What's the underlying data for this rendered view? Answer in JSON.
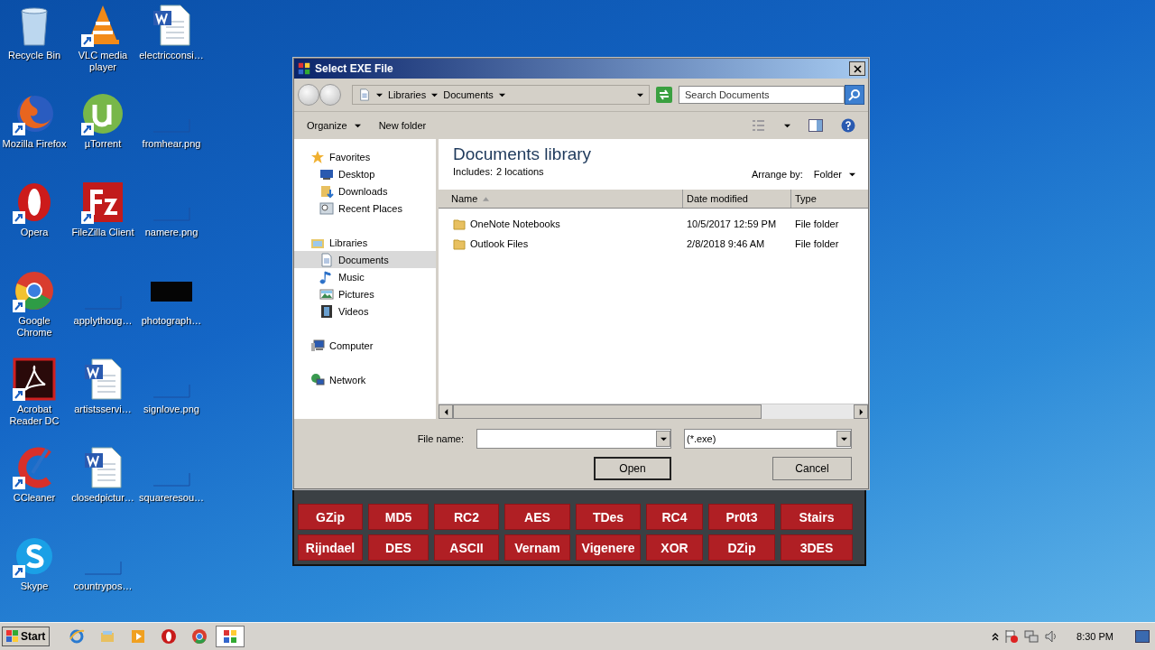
{
  "desktop": {
    "icons": [
      {
        "label": "Recycle Bin",
        "kind": "recycle",
        "shortcut": false
      },
      {
        "label": "Mozilla Firefox",
        "kind": "firefox",
        "shortcut": true
      },
      {
        "label": "Opera",
        "kind": "opera",
        "shortcut": true
      },
      {
        "label": "Google Chrome",
        "kind": "chrome",
        "shortcut": true
      },
      {
        "label": "Acrobat Reader DC",
        "kind": "acrobat",
        "shortcut": true
      },
      {
        "label": "CCleaner",
        "kind": "ccleaner",
        "shortcut": true
      },
      {
        "label": "Skype",
        "kind": "skype",
        "shortcut": true
      },
      {
        "label": "VLC media player",
        "kind": "vlc",
        "shortcut": true
      },
      {
        "label": "µTorrent",
        "kind": "utorrent",
        "shortcut": true
      },
      {
        "label": "FileZilla Client",
        "kind": "filezilla",
        "shortcut": true
      },
      {
        "label": "applythoug…",
        "kind": "image",
        "shortcut": false
      },
      {
        "label": "artistsservi…",
        "kind": "word",
        "shortcut": false
      },
      {
        "label": "closedpictur…",
        "kind": "word",
        "shortcut": false
      },
      {
        "label": "countrypos…",
        "kind": "image",
        "shortcut": false
      },
      {
        "label": "electricconsi…",
        "kind": "word",
        "shortcut": false
      },
      {
        "label": "fromhear.png",
        "kind": "image",
        "shortcut": false
      },
      {
        "label": "namere.png",
        "kind": "image",
        "shortcut": false
      },
      {
        "label": "photograph…",
        "kind": "dark-image",
        "shortcut": false
      },
      {
        "label": "signlove.png",
        "kind": "image",
        "shortcut": false
      },
      {
        "label": "squareresou…",
        "kind": "image",
        "shortcut": false
      }
    ]
  },
  "app_window": {
    "buttons": [
      [
        "GZip",
        "MD5",
        "RC2",
        "AES",
        "TDes",
        "RC4",
        "Pr0t3",
        "Stairs"
      ],
      [
        "Rijndael",
        "DES",
        "ASCII",
        "Vernam",
        "Vigenere",
        "XOR",
        "DZip",
        "3DES"
      ]
    ]
  },
  "dialog": {
    "title": "Select EXE File",
    "breadcrumb": [
      "Libraries",
      "Documents"
    ],
    "search": {
      "placeholder": "Search Documents"
    },
    "toolbar": [
      "Organize",
      "New folder"
    ],
    "nav": [
      {
        "label": "Favorites",
        "kind": "favorites",
        "selected": false,
        "children": [
          {
            "label": "Desktop",
            "kind": "desktop",
            "selected": false
          },
          {
            "label": "Downloads",
            "kind": "downloads",
            "selected": false
          },
          {
            "label": "Recent Places",
            "kind": "recent",
            "selected": false
          }
        ]
      },
      {
        "label": "Libraries",
        "kind": "libraries",
        "selected": false,
        "children": [
          {
            "label": "Documents",
            "kind": "documents",
            "selected": true
          },
          {
            "label": "Music",
            "kind": "music",
            "selected": false
          },
          {
            "label": "Pictures",
            "kind": "pictures",
            "selected": false
          },
          {
            "label": "Videos",
            "kind": "videos",
            "selected": false
          }
        ]
      },
      {
        "label": "Computer",
        "kind": "computer",
        "selected": false
      },
      {
        "label": "Network",
        "kind": "network",
        "selected": false
      }
    ],
    "library_title": "Documents library",
    "includes_label": "Includes:",
    "includes_link": "2 locations",
    "arrange_label": "Arrange by:",
    "arrange_value": "Folder",
    "columns": [
      {
        "label": "Name",
        "sorted": true
      },
      {
        "label": "Date modified",
        "sorted": false
      },
      {
        "label": "Type",
        "sorted": false
      }
    ],
    "rows": [
      {
        "name": "OneNote Notebooks",
        "date": "10/5/2017 12:59 PM",
        "type": "File folder"
      },
      {
        "name": "Outlook Files",
        "date": "2/8/2018 9:46 AM",
        "type": "File folder"
      }
    ],
    "file_name_label": "File name:",
    "file_type": "(*.exe)",
    "buttons": [
      "Open",
      "Cancel"
    ]
  },
  "taskbar": {
    "start": "Start",
    "apps": [
      {
        "kind": "ie",
        "selected": false
      },
      {
        "kind": "explorer",
        "selected": false
      },
      {
        "kind": "media",
        "selected": false
      },
      {
        "kind": "opera",
        "selected": false
      },
      {
        "kind": "chrome",
        "selected": false
      },
      {
        "kind": "app",
        "selected": true
      }
    ],
    "clock": "8:30 PM"
  }
}
